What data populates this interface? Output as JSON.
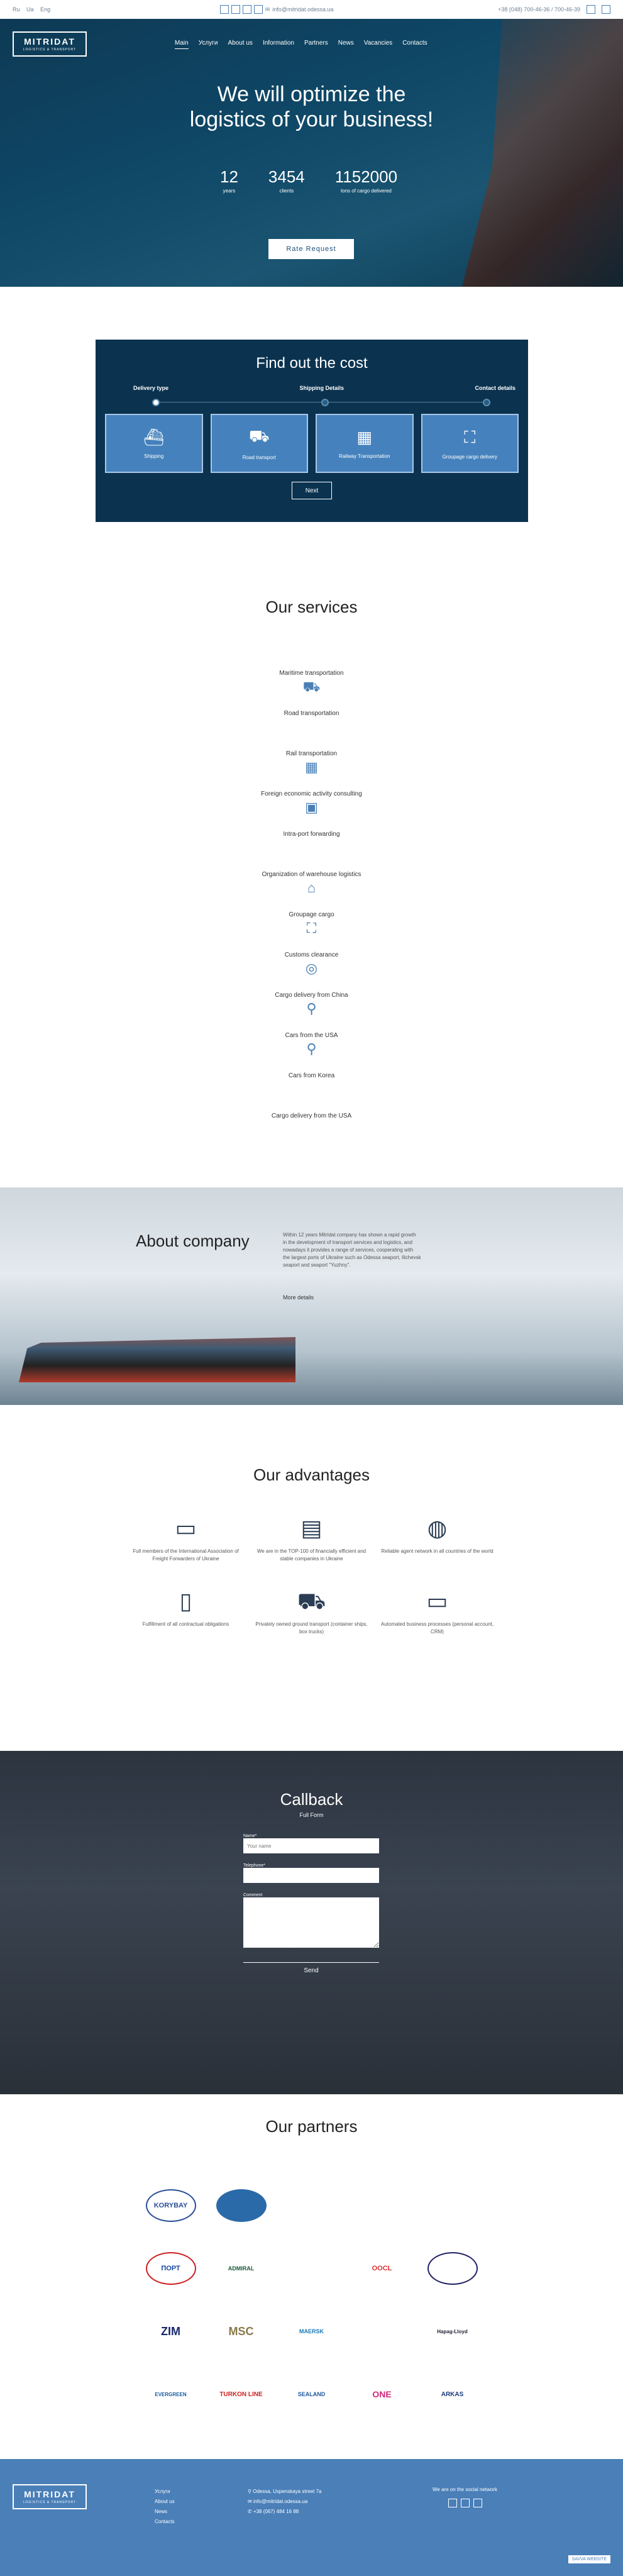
{
  "topbar": {
    "langs": [
      "Ru",
      "Ua",
      "Eng"
    ],
    "email": "info@mitridat.odessa.ua",
    "phone": "+38 (048) 700-46-36 / 700-46-39"
  },
  "nav": {
    "logo_name": "MITRIDAT",
    "logo_sub": "LOGISTICS & TRANSPORT",
    "items": [
      "Main",
      "Услуги",
      "About us",
      "Information",
      "Partners",
      "News",
      "Vacancies",
      "Contacts"
    ]
  },
  "hero": {
    "title": "We will optimize the logistics of your business!",
    "stats": [
      {
        "value": "12",
        "label": "years"
      },
      {
        "value": "3454",
        "label": "clients"
      },
      {
        "value": "1152000",
        "label": "tons of cargo delivered"
      }
    ],
    "button": "Rate Request"
  },
  "cost": {
    "title": "Find out the cost",
    "steps": [
      "Delivery type",
      "Shipping Details",
      "Contact details"
    ],
    "cards": [
      "Shipping",
      "Road transport",
      "Railway Transportation",
      "Groupage cargo delivery"
    ],
    "next": "Next"
  },
  "services": {
    "title": "Our services",
    "items": [
      "Maritime transportation",
      "Road transportation",
      "Rail transportation",
      "Foreign economic activity consulting",
      "Intra-port forwarding",
      "Organization of warehouse logistics",
      "Groupage cargo",
      "Customs clearance",
      "Cargo delivery from China",
      "Cars from the USA",
      "Cars from Korea",
      "Cargo delivery from the USA"
    ]
  },
  "about": {
    "title": "About company",
    "text": "Within 12 years Mitridat company has shown a rapid growth in the development of transport services and logistics, and nowadays it provides a range of services, cooperating with the largest ports of Ukraine such as Odessa seaport, Ilichevsk seaport and seaport \"Yuzhny\".",
    "more": "More details"
  },
  "advantages": {
    "title": "Our advantages",
    "items": [
      "Full members of the International Association of Freight Forwarders of Ukraine",
      "We are in the TOP-100 of financially efficient and stable companies in Ukraine",
      "Reliable agent network in all countries of the world",
      "Fulfillment of all contractual obligations",
      "Privately owned ground transport (container ships, box trucks)",
      "Automated business processes (personal account, CRM)"
    ]
  },
  "callback": {
    "title": "Callback",
    "sub": "Full Form",
    "name_label": "Name*",
    "name_placeholder": "Your name",
    "phone_label": "Telephone*",
    "comment_label": "Comment",
    "send": "Send"
  },
  "partners": {
    "title": "Our partners",
    "logos": [
      "KORYBAY",
      "",
      "",
      "",
      "",
      "ПОРТ",
      "ADMIRAL",
      "",
      "OOCL",
      "",
      "ZIM",
      "MSC",
      "MAERSK",
      "",
      "Hapag-Lloyd",
      "EVERGREEN",
      "TURKON LINE",
      "SEALAND",
      "ONE",
      "ARKAS"
    ]
  },
  "footer": {
    "menu": [
      "Услуги",
      "About us",
      "News",
      "Contacts"
    ],
    "address": "Odessa, Uspenskaya street 7a",
    "email": "info@mitridat.odessa.ua",
    "phone": "+38 (067) 484 16 88",
    "social_title": "We are on the social network",
    "badge": "SAVVA WEBSITE"
  }
}
